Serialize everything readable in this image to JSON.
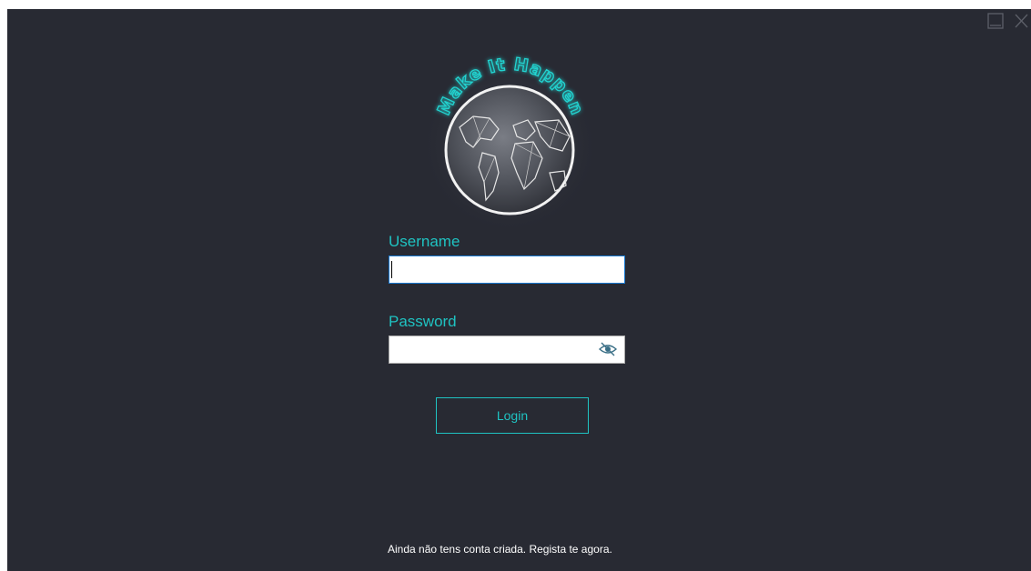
{
  "window": {
    "controls": [
      {
        "icon": "minimize-icon"
      },
      {
        "icon": "close-icon"
      }
    ]
  },
  "logo": {
    "text": "Make It Happen",
    "icon": "globe-icon"
  },
  "form": {
    "username_label": "Username",
    "username_value": "",
    "password_label": "Password",
    "password_value": "",
    "password_toggle_icon": "eye-icon",
    "login_label": "Login"
  },
  "footer": {
    "register_text": "Ainda não tens conta criada. Regista te agora."
  },
  "colors": {
    "background": "#282a33",
    "accent": "#1fc3c2",
    "text": "#ffffff",
    "focus_border": "#1a7bd3"
  }
}
